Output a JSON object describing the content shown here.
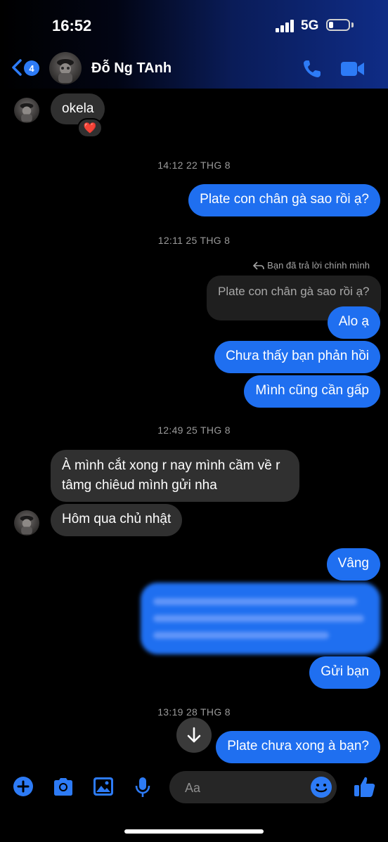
{
  "status_bar": {
    "time": "16:52",
    "network": "5G"
  },
  "header": {
    "back_badge": "4",
    "contact_name": "Đỗ Ng TAnh"
  },
  "messages": {
    "m1": {
      "text": "okela",
      "reaction": "❤️"
    },
    "ts1": "14:12 22 THG 8",
    "m2": "Plate con chân gà sao rồi ạ?",
    "ts2": "12:11 25 THG 8",
    "reply_note": "Bạn đã trả lời chính mình",
    "quoted": "Plate con chân gà sao rồi ạ?",
    "m3": "Alo ạ",
    "m4": "Chưa thấy bạn phản hồi",
    "m5": "Mình cũng cần gấp",
    "ts3": "12:49 25 THG 8",
    "m6_line1": "À mình cắt xong r nay mình cầm về r",
    "m6_line2": "tâmg chiêud mình gửi nha",
    "m7": "Hôm qua chủ nhật",
    "m8": "Vâng",
    "m10": "Gửi bạn",
    "ts4": "13:19 28 THG 8",
    "m11": "Plate chưa xong à bạn?"
  },
  "composer": {
    "placeholder": "Aa"
  },
  "colors": {
    "accent": "#1f6ff0",
    "incoming": "#303030"
  }
}
